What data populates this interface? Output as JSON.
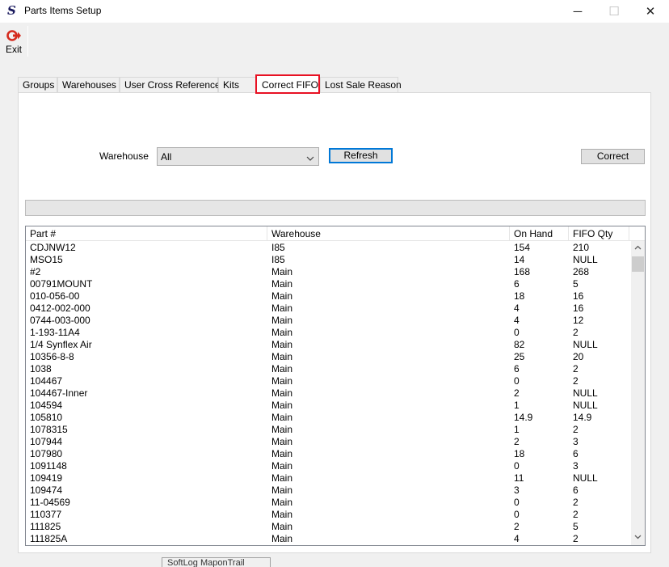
{
  "window": {
    "title": "Parts Items Setup",
    "minimize_glyph": "─",
    "maximize_glyph": "☐",
    "close_glyph": "✕"
  },
  "toolbar": {
    "exit_label": "Exit",
    "exit_icon": "exit-icon",
    "exit_color": "#d52b1e"
  },
  "tabs": [
    {
      "label": "Groups"
    },
    {
      "label": "Warehouses"
    },
    {
      "label": "User Cross Reference"
    },
    {
      "label": "Kits"
    },
    {
      "label": "Correct FIFO",
      "active": true
    },
    {
      "label": "Lost Sale Reason"
    }
  ],
  "form": {
    "warehouse_label": "Warehouse",
    "warehouse_value": "All",
    "refresh_label": "Refresh",
    "correct_label": "Correct"
  },
  "grid": {
    "columns": [
      "Part #",
      "Warehouse",
      "On Hand",
      "FIFO Qty"
    ],
    "rows": [
      [
        "CDJNW12",
        "I85",
        "154",
        "210"
      ],
      [
        "MSO15",
        "I85",
        "14",
        "NULL"
      ],
      [
        "#2",
        "Main",
        "168",
        "268"
      ],
      [
        "00791MOUNT",
        "Main",
        "6",
        "5"
      ],
      [
        "010-056-00",
        "Main",
        "18",
        "16"
      ],
      [
        "0412-002-000",
        "Main",
        "4",
        "16"
      ],
      [
        "0744-003-000",
        "Main",
        "4",
        "12"
      ],
      [
        "1-193-11A4",
        "Main",
        "0",
        "2"
      ],
      [
        "1/4 Synflex Air",
        "Main",
        "82",
        "NULL"
      ],
      [
        "10356-8-8",
        "Main",
        "25",
        "20"
      ],
      [
        "1038",
        "Main",
        "6",
        "2"
      ],
      [
        "104467",
        "Main",
        "0",
        "2"
      ],
      [
        "104467-Inner",
        "Main",
        "2",
        "NULL"
      ],
      [
        "104594",
        "Main",
        "1",
        "NULL"
      ],
      [
        "105810",
        "Main",
        "14.9",
        "14.9"
      ],
      [
        "1078315",
        "Main",
        "1",
        "2"
      ],
      [
        "107944",
        "Main",
        "2",
        "3"
      ],
      [
        "107980",
        "Main",
        "18",
        "6"
      ],
      [
        "1091148",
        "Main",
        "0",
        "3"
      ],
      [
        "109419",
        "Main",
        "11",
        "NULL"
      ],
      [
        "109474",
        "Main",
        "3",
        "6"
      ],
      [
        "11-04569",
        "Main",
        "0",
        "2"
      ],
      [
        "110377",
        "Main",
        "0",
        "2"
      ],
      [
        "111825",
        "Main",
        "2",
        "5"
      ],
      [
        "111825A",
        "Main",
        "4",
        "2"
      ]
    ]
  },
  "bottom_tab": {
    "label": "SoftLog MaponTrail"
  }
}
